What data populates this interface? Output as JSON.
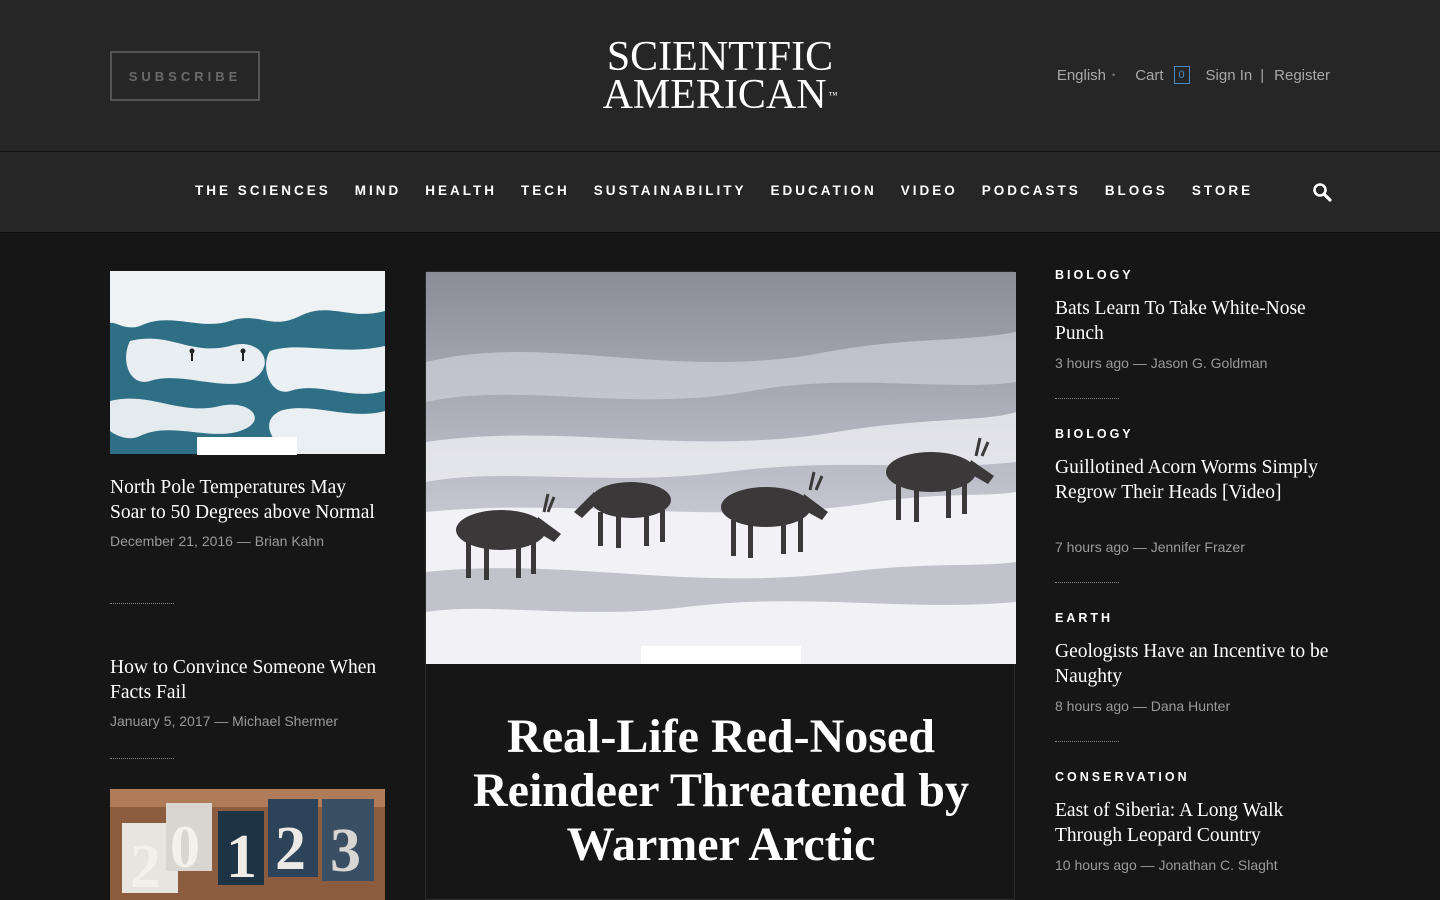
{
  "header": {
    "subscribe_label": "SUBSCRIBE",
    "logo_line1": "SCIENTIFIC",
    "logo_line2": "AMERICAN",
    "logo_tm": "™",
    "language": "English",
    "cart_label": "Cart",
    "cart_count": "0",
    "signin_label": "Sign In",
    "separator": "|",
    "register_label": "Register"
  },
  "nav": {
    "items": [
      "THE SCIENCES",
      "MIND",
      "HEALTH",
      "TECH",
      "SUSTAINABILITY",
      "EDUCATION",
      "VIDEO",
      "PODCASTS",
      "BLOGS",
      "STORE"
    ],
    "search_icon": "search-icon"
  },
  "left": {
    "articles": [
      {
        "title": "North Pole Temperatures May Soar to 50 Degrees above Normal",
        "meta": "December 21, 2016 — Brian Kahn"
      },
      {
        "title": "How to Convince Someone When Facts Fail",
        "meta": "January 5, 2017 — Michael Shermer"
      }
    ]
  },
  "hero": {
    "title": "Real-Life Red-Nosed Reindeer Threatened by Warmer Arctic"
  },
  "right": {
    "articles": [
      {
        "category": "BIOLOGY",
        "title": "Bats Learn To Take White-Nose Punch",
        "meta": "3 hours ago — Jason G. Goldman"
      },
      {
        "category": "BIOLOGY",
        "title": "Guillotined Acorn Worms Simply Regrow Their Heads [Video]",
        "meta": "7 hours ago — Jennifer Frazer"
      },
      {
        "category": "EARTH",
        "title": "Geologists Have an Incentive to be Naughty",
        "meta": "8 hours ago — Dana Hunter"
      },
      {
        "category": "CONSERVATION",
        "title": "East of Siberia: A Long Walk Through Leopard Country",
        "meta": "10 hours ago — Jonathan C. Slaght"
      }
    ]
  },
  "colors": {
    "header_bg": "#262626",
    "page_bg": "#161616",
    "cart_badge": "#4a8ac4"
  }
}
